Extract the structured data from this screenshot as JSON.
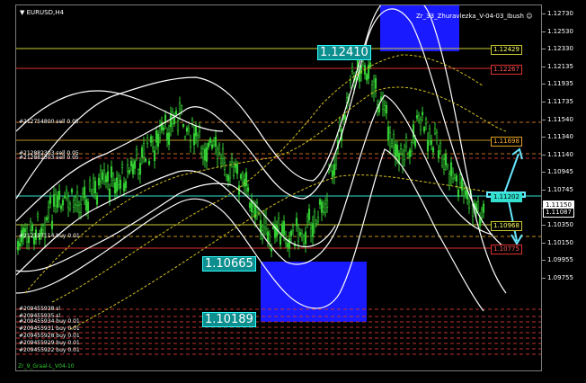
{
  "window": {
    "symbol_timeframe": "EURUSD,H4",
    "indicator_name": "Zr_33_Zhuravlezka_V-04-03_Ibush",
    "smiley_icon": "smiley-icon",
    "footer_label": "Zr_9_Graal-L_V04-10"
  },
  "price_axis": {
    "ticks": [
      "1.12730",
      "1.12530",
      "1.12330",
      "1.12135",
      "1.11935",
      "1.11735",
      "1.11540",
      "1.11340",
      "1.11140",
      "1.10945",
      "1.10745",
      "1.10550",
      "1.10350",
      "1.10150",
      "1.09955",
      "1.09755"
    ]
  },
  "price_tags": [
    {
      "label": "1.12429",
      "line_color": "#cccc33",
      "text_color": "#ffff66"
    },
    {
      "label": "1.12267",
      "line_color": "#e03030",
      "text_color": "#ff5555"
    },
    {
      "label": "1.11698",
      "line_color": "#e0a020",
      "text_color": "#ffb030"
    },
    {
      "label": "1.11202",
      "line_color": "#33e0d0",
      "text_color": "#000000"
    },
    {
      "label": "1.11150",
      "line_color": "#ffffff",
      "text_color": "#000000"
    },
    {
      "label": "1.11087",
      "line_color": "#ffffff",
      "text_color": "#ffffff"
    },
    {
      "label": "1.10968",
      "line_color": "#cccc33",
      "text_color": "#ffff66"
    },
    {
      "label": "1.10775",
      "line_color": "#e03030",
      "text_color": "#ff5555"
    }
  ],
  "level_labels": {
    "top_extreme": "1.12410",
    "middle_extreme": "1.10665",
    "bottom_extreme": "1.10189"
  },
  "order_labels": [
    "#212754800 sell 0.05",
    "#212882303 sell 0.05",
    "#212882303 sell 0.05",
    "#212157114 buy 0.01",
    "#209455938 sl",
    "#209455935 sl",
    "#209455934 buy 0.01",
    "#209455931 buy 0.01",
    "#209455928 buy 0.01",
    "#209455929 buy 0.01",
    "#209455922 buy 0.01"
  ],
  "colors": {
    "candle_green": "#33cc33",
    "band_white": "#ffffff",
    "zone_blue": "#1a1aff",
    "arrow_cyan": "#66e8ff"
  }
}
